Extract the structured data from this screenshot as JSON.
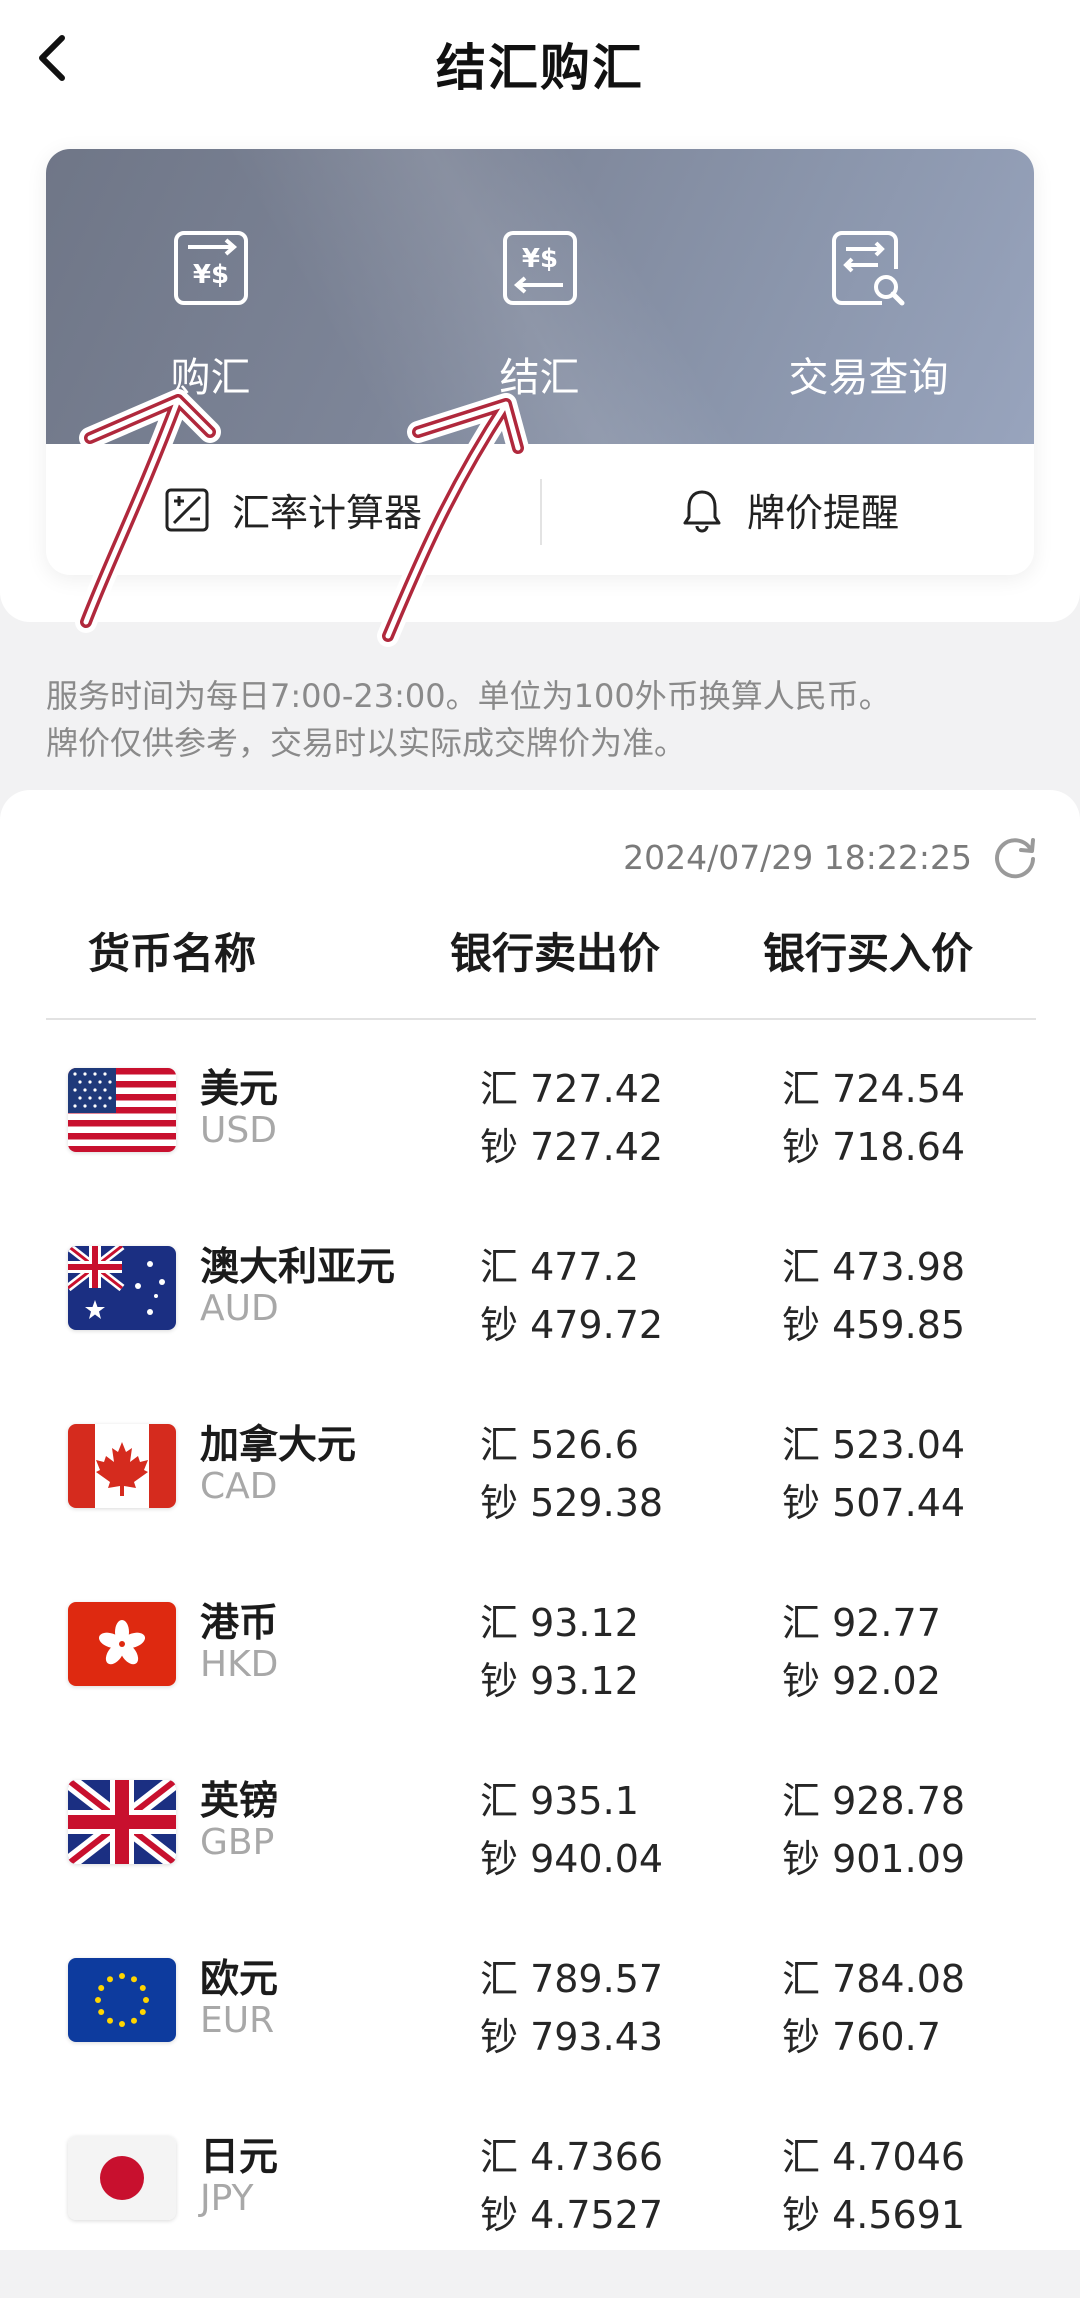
{
  "header": {
    "title": "结汇购汇"
  },
  "features": [
    {
      "label": "购汇",
      "icon": "buy-exchange-icon"
    },
    {
      "label": "结汇",
      "icon": "settle-exchange-icon"
    },
    {
      "label": "交易查询",
      "icon": "transaction-query-icon"
    }
  ],
  "tools": [
    {
      "label": "汇率计算器",
      "icon": "calculator-icon"
    },
    {
      "label": "牌价提醒",
      "icon": "bell-icon"
    }
  ],
  "notice": {
    "line1": "服务时间为每日7:00-23:00。单位为100外币换算人民币。",
    "line2": "牌价仅供参考，交易时以实际成交牌价为准。"
  },
  "rates": {
    "timestamp": "2024/07/29 18:22:25",
    "headers": {
      "name": "货币名称",
      "sell": "银行卖出价",
      "buy": "银行买入价"
    },
    "rows": [
      {
        "name": "美元",
        "code": "USD",
        "sell_hui": "汇 727.42",
        "sell_chao": "钞 727.42",
        "buy_hui": "汇 724.54",
        "buy_chao": "钞 718.64"
      },
      {
        "name": "澳大利亚元",
        "code": "AUD",
        "sell_hui": "汇 477.2",
        "sell_chao": "钞 479.72",
        "buy_hui": "汇 473.98",
        "buy_chao": "钞 459.85"
      },
      {
        "name": "加拿大元",
        "code": "CAD",
        "sell_hui": "汇 526.6",
        "sell_chao": "钞 529.38",
        "buy_hui": "汇 523.04",
        "buy_chao": "钞 507.44"
      },
      {
        "name": "港币",
        "code": "HKD",
        "sell_hui": "汇 93.12",
        "sell_chao": "钞 93.12",
        "buy_hui": "汇 92.77",
        "buy_chao": "钞 92.02"
      },
      {
        "name": "英镑",
        "code": "GBP",
        "sell_hui": "汇 935.1",
        "sell_chao": "钞 940.04",
        "buy_hui": "汇 928.78",
        "buy_chao": "钞 901.09"
      },
      {
        "name": "欧元",
        "code": "EUR",
        "sell_hui": "汇 789.57",
        "sell_chao": "钞 793.43",
        "buy_hui": "汇 784.08",
        "buy_chao": "钞 760.7"
      },
      {
        "name": "日元",
        "code": "JPY",
        "sell_hui": "汇 4.7366",
        "sell_chao": "钞 4.7527",
        "buy_hui": "汇 4.7046",
        "buy_chao": "钞 4.5691"
      }
    ]
  },
  "colors": {
    "banner": "#7d8598",
    "annotation_arrow": "#b0283c"
  }
}
